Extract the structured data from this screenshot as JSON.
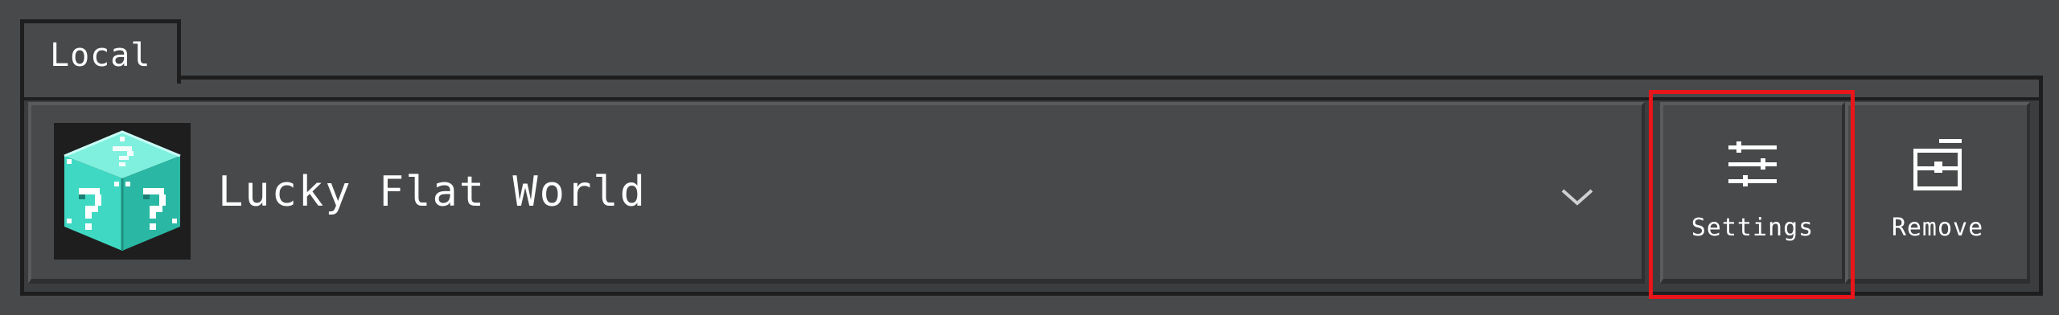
{
  "tabs": [
    {
      "label": "Local"
    }
  ],
  "world": {
    "name": "Lucky Flat World",
    "thumbnail_icon": "lucky-block-icon",
    "expand_icon": "chevron-down-icon"
  },
  "actions": {
    "settings": {
      "label": "Settings",
      "icon": "sliders-icon"
    },
    "remove": {
      "label": "Remove",
      "icon": "remove-icon"
    }
  },
  "colors": {
    "background": "#48494a",
    "panel": "#3c3d3e",
    "border": "#1e1e1f",
    "highlight": "#e8151a",
    "text": "#ffffff",
    "lucky_block": "#3fd9c3"
  }
}
